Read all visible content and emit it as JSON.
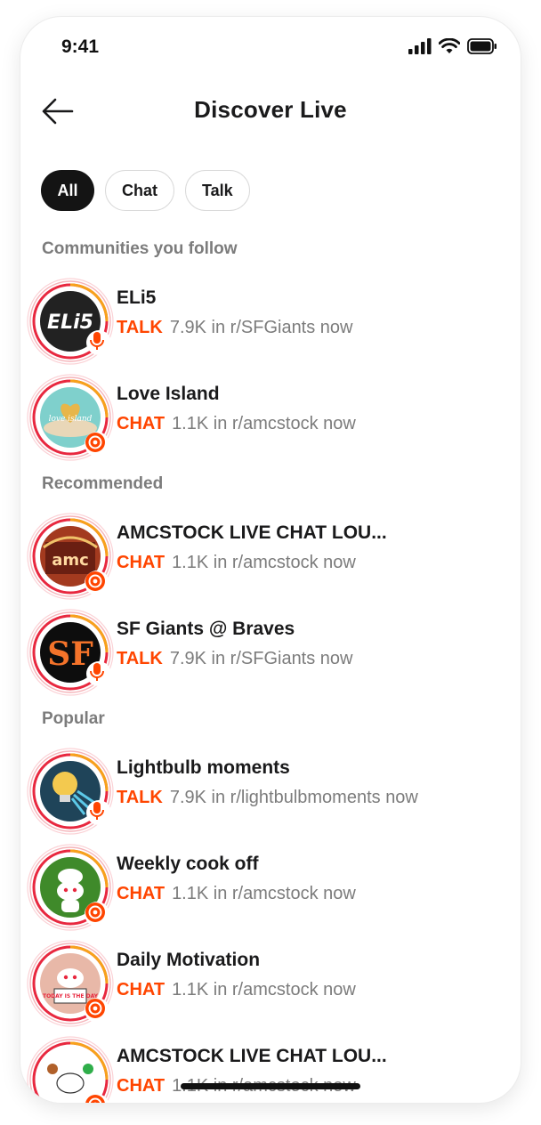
{
  "status": {
    "time": "9:41"
  },
  "header": {
    "title": "Discover Live"
  },
  "filters": [
    {
      "label": "All",
      "active": true
    },
    {
      "label": "Chat",
      "active": false
    },
    {
      "label": "Talk",
      "active": false
    }
  ],
  "sections": {
    "following": "Communities you follow",
    "recommended": "Recommended",
    "popular": "Popular"
  },
  "rooms": [
    {
      "title": "ELi5",
      "kind": "TALK",
      "meta": "7.9K in r/SFGiants now",
      "icon": "eli5-logo",
      "avatar_label": "ELi5",
      "color": "#222222"
    },
    {
      "title": "Love Island",
      "kind": "CHAT",
      "meta": "1.1K in r/amcstock now",
      "icon": "love-island-logo",
      "avatar_label": "love island",
      "color": "#7fd0cc"
    },
    {
      "title": "AMCSTOCK LIVE CHAT LOU...",
      "kind": "CHAT",
      "meta": "1.1K in r/amcstock now",
      "icon": "amc-theater-logo",
      "avatar_label": "amc",
      "color": "#a33a1f"
    },
    {
      "title": "SF Giants @ Braves",
      "kind": "TALK",
      "meta": "7.9K in r/SFGiants now",
      "icon": "sf-giants-logo",
      "avatar_label": "SF",
      "color": "#0d0d0d"
    },
    {
      "title": "Lightbulb moments",
      "kind": "TALK",
      "meta": "7.9K in r/lightbulbmoments now",
      "icon": "lightbulb-icon",
      "avatar_label": "",
      "color": "#1f4459"
    },
    {
      "title": "Weekly cook off",
      "kind": "CHAT",
      "meta": "1.1K in r/amcstock now",
      "icon": "chef-snoo-icon",
      "avatar_label": "",
      "color": "#3f8a2a"
    },
    {
      "title": "Daily Motivation",
      "kind": "CHAT",
      "meta": "1.1K in r/amcstock now",
      "icon": "motivation-snoo-icon",
      "avatar_label": "TODAY IS THE DAY",
      "color": "#e8b8a8"
    },
    {
      "title": "AMCSTOCK LIVE CHAT LOU...",
      "kind": "CHAT",
      "meta": "1.1K in r/amcstock now",
      "icon": "snoo-badges-icon",
      "avatar_label": "",
      "color": "#ffffff"
    }
  ],
  "colors": {
    "accent": "#ff4500",
    "ring_orange": "#f7a21b",
    "ring_red": "#e8283f"
  }
}
